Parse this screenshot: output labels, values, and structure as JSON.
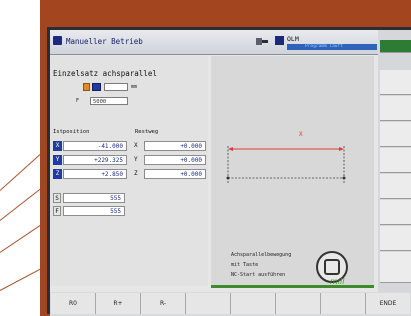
{
  "header": {
    "title": "Manueller Betrieb",
    "status_label": "OLM",
    "status_sub": "Programm läuft"
  },
  "left_panel": {
    "section_title": "Einzelsatz achsparallel",
    "spindle_unit": "mm",
    "feed_label": "F",
    "feed_value": "5000",
    "ist_title": "Istposition",
    "rest_title": "Restweg",
    "axes": [
      {
        "name": "X",
        "ist": "-41.000",
        "rest_name": "X",
        "rest": "+0.000"
      },
      {
        "name": "Y",
        "ist": "+229.325",
        "rest_name": "Y",
        "rest": "+0.000"
      },
      {
        "name": "Z",
        "ist": "+2.850",
        "rest_name": "Z",
        "rest": "+0.000"
      }
    ],
    "s_label": "S",
    "s_value": "555",
    "f2_label": "F",
    "f2_value": "555"
  },
  "graphic": {
    "axis_label": "X",
    "hint_lines": [
      "Achsparallelbewegung",
      "mit Taste",
      "NC-Start ausführen"
    ],
    "brand": "mill"
  },
  "softkeys": {
    "bottom": [
      "R0",
      "R+",
      "R-",
      "",
      "",
      "",
      "",
      "ENDE"
    ]
  },
  "colors": {
    "accent_blue": "#233aa3",
    "accent_orange": "#e58b1f",
    "brand_green": "#3d8b2b",
    "arrow_red": "#e03a3a"
  }
}
